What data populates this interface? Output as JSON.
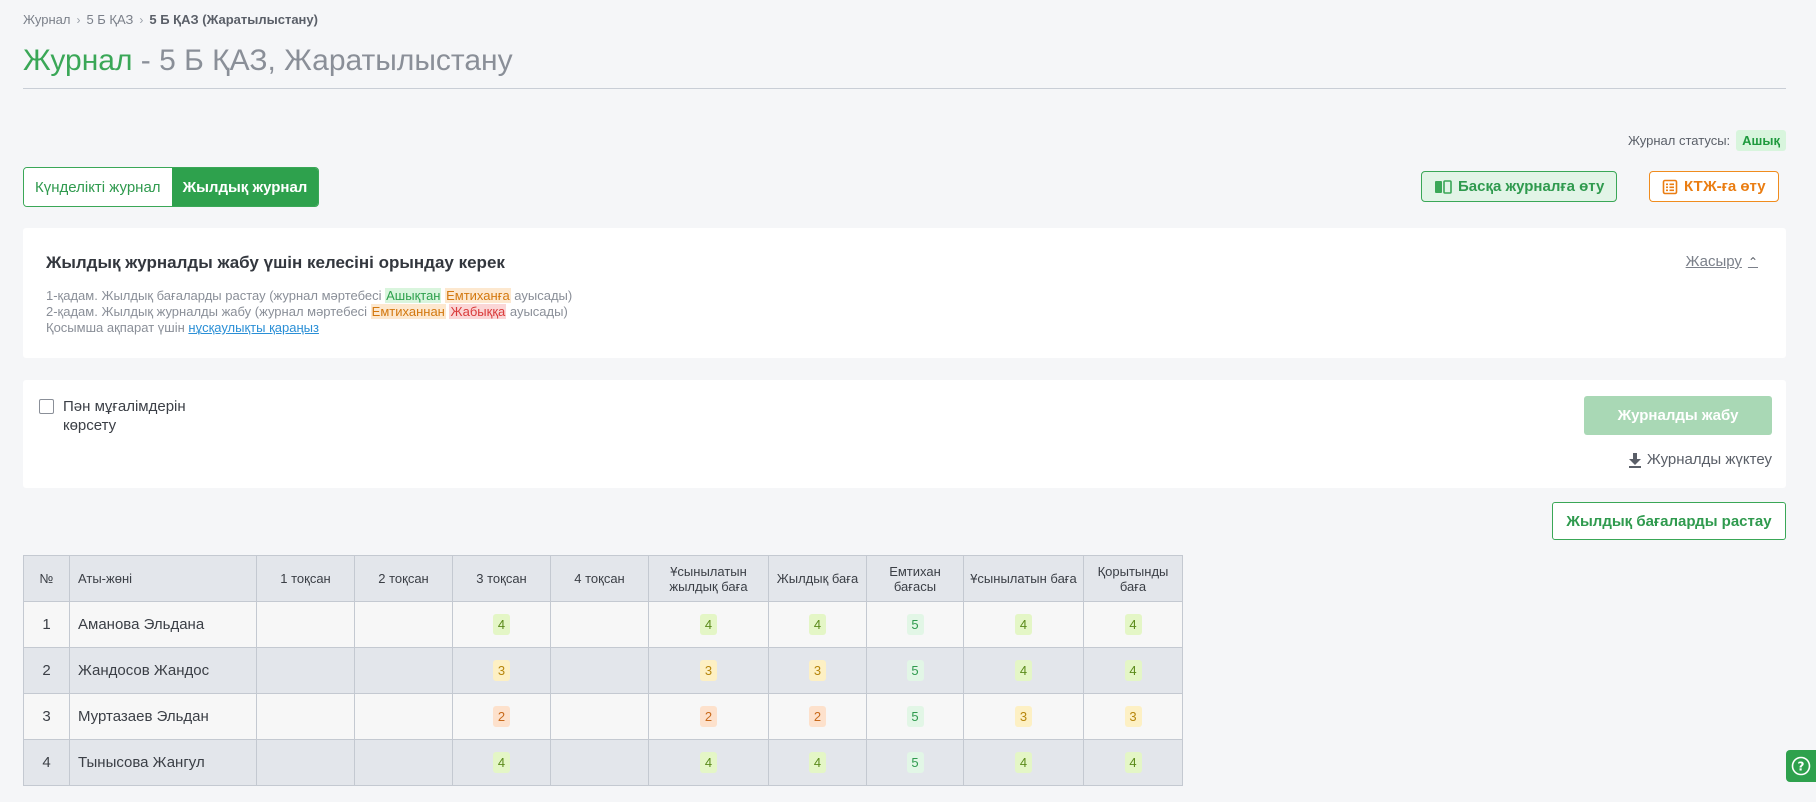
{
  "breadcrumb": {
    "items": [
      "Журнал",
      "5 Б ҚАЗ"
    ],
    "current": "5 Б ҚАЗ (Жаратылыстану)"
  },
  "title": {
    "main": "Журнал",
    "rest": " - 5 Б ҚАЗ, Жаратылыстану"
  },
  "status": {
    "label": "Журнал статусы:",
    "value": "Ашық"
  },
  "tabs": [
    {
      "label": "Күнделікті журнал"
    },
    {
      "label": "Жылдық журнал"
    }
  ],
  "buttons": {
    "other_journal": "Басқа журналға өту",
    "ktzh": "КТЖ-ға өту"
  },
  "info": {
    "heading": "Жылдық журналды жабу үшін келесіні орындау керек",
    "hide": "Жасыру",
    "step1": {
      "pre": "1-қадам. Жылдық бағаларды растау (журнал мәртебесі ",
      "a": "Ашықтан",
      "b": "Емтиханға",
      "post": " ауысады)"
    },
    "step2": {
      "pre": "2-қадам. Жылдық журналды жабу (журнал мәртебесі ",
      "a": "Емтиханнан",
      "b": "Жабыққа",
      "post": " ауысады)"
    },
    "more": {
      "pre": "Қосымша ақпарат үшін ",
      "link": "нұсқаулықты қараңыз"
    }
  },
  "controls": {
    "checkbox_line1": "Пән мұғалімдерін",
    "checkbox_line2": "көрсету",
    "close_button": "Журналды жабу",
    "download": "Журналды жүктеу",
    "confirm_button": "Жылдық бағаларды растау"
  },
  "table": {
    "headers": {
      "num": "№",
      "name": "Аты-жөні",
      "q1": "1 тоқсан",
      "q2": "2 тоқсан",
      "q3": "3 тоқсан",
      "q4": "4 тоқсан",
      "rec_annual_1": "Ұсынылатын",
      "rec_annual_2": "жылдық баға",
      "annual": "Жылдық баға",
      "exam_1": "Емтихан",
      "exam_2": "бағасы",
      "recommended": "Ұсынылатын баға",
      "final_1": "Қорытынды",
      "final_2": "баға"
    },
    "rows": [
      {
        "num": "1",
        "name": "Аманова Эльдана",
        "q3": "4",
        "rec": "4",
        "annual": "4",
        "exam": "5",
        "recg": "4",
        "final": "4"
      },
      {
        "num": "2",
        "name": "Жандосов Жандос",
        "q3": "3",
        "rec": "3",
        "annual": "3",
        "exam": "5",
        "recg": "4",
        "final": "4"
      },
      {
        "num": "3",
        "name": "Муртазаев Эльдан",
        "q3": "2",
        "rec": "2",
        "annual": "2",
        "exam": "5",
        "recg": "3",
        "final": "3"
      },
      {
        "num": "4",
        "name": "Тынысова Жангул",
        "q3": "4",
        "rec": "4",
        "annual": "4",
        "exam": "5",
        "recg": "4",
        "final": "4"
      }
    ]
  },
  "colors": {
    "brand_green": "#2ea14d",
    "orange": "#f08c1e",
    "status_bg": "#d8f5dd"
  }
}
